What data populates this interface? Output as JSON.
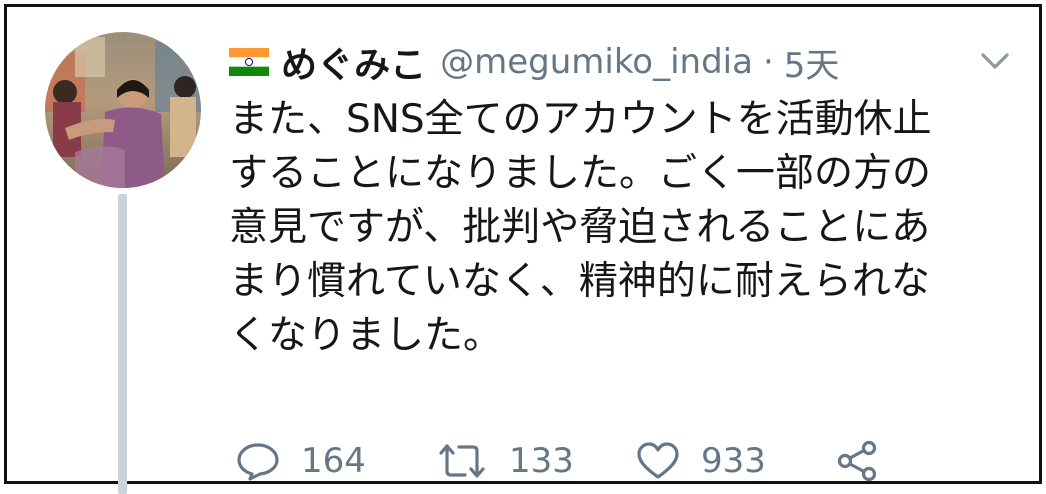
{
  "user": {
    "flag": "india-flag",
    "display_name": "めぐみこ",
    "handle": "@megumiko_india",
    "separator": "·",
    "timestamp": "5天"
  },
  "tweet": {
    "lines": [
      "また、SNS全てのアカウントを活動休止",
      "することになりました。ごく一部の方の",
      "意見ですが、批判や脅迫されることにあ",
      "まり慣れていなく、精神的に耐えられな",
      "くなりました。"
    ]
  },
  "actions": {
    "reply_count": "164",
    "retweet_count": "133",
    "like_count": "933"
  },
  "icons": {
    "reply": "reply-icon",
    "retweet": "retweet-icon",
    "like": "heart-icon",
    "share": "share-icon",
    "menu": "chevron-down-icon"
  },
  "colors": {
    "text": "#14171a",
    "secondary": "#657786",
    "thread_line": "#c9d3dc",
    "icon": "#657786"
  }
}
